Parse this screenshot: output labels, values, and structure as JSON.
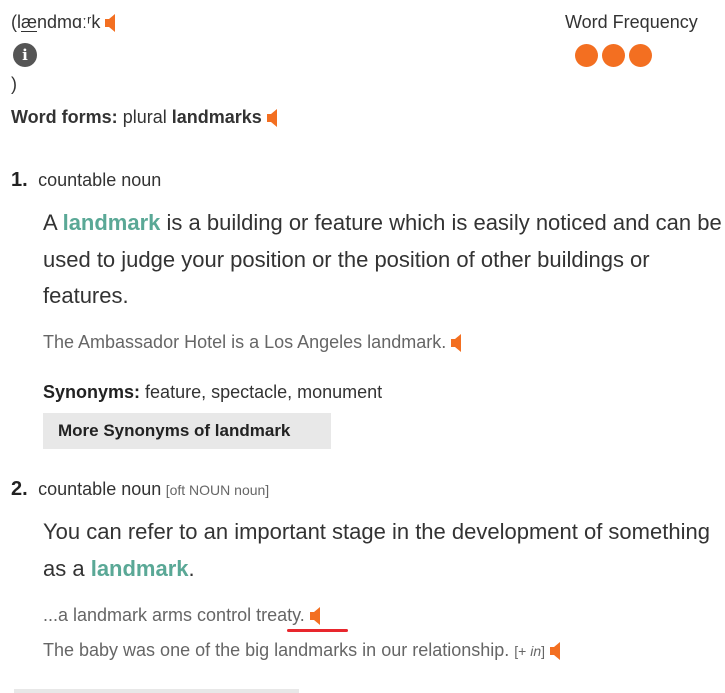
{
  "pronunciation": {
    "open": "(l",
    "ae": "æ",
    "rest": "ndmɑːʳk",
    "close": ")",
    "info_icon": "i"
  },
  "frequency": {
    "label": "Word Frequency",
    "dots": 3,
    "color": "#f36f21"
  },
  "word_forms": {
    "label": "Word forms:",
    "type": "plural",
    "form": "landmarks"
  },
  "senses": [
    {
      "number": "1.",
      "pos": "countable noun",
      "def_before": "A ",
      "headword": "landmark",
      "def_after": " is a building or feature which is easily noticed and can be used to judge your position or the position of other buildings or features.",
      "example": "The Ambassador Hotel is a Los Angeles landmark.",
      "synonyms_label": "Synonyms:",
      "synonyms": "feature, spectacle, monument",
      "more_synonyms": "More Synonyms of landmark"
    },
    {
      "number": "2.",
      "pos": "countable noun",
      "gram": "[oft NOUN noun]",
      "def_before": "You can refer to an important stage in the development of something as a ",
      "headword": "landmark",
      "def_after": ".",
      "example1": "...a landmark arms control treaty.",
      "example2": "The baby was one of the big landmarks in our relationship.",
      "example2_gram_open": "[+ ",
      "example2_gram_word": "in",
      "example2_gram_close": "]"
    }
  ],
  "colors": {
    "accent_orange": "#f36f21",
    "headword_green": "#5aa896",
    "underline_red": "#e8262d"
  }
}
